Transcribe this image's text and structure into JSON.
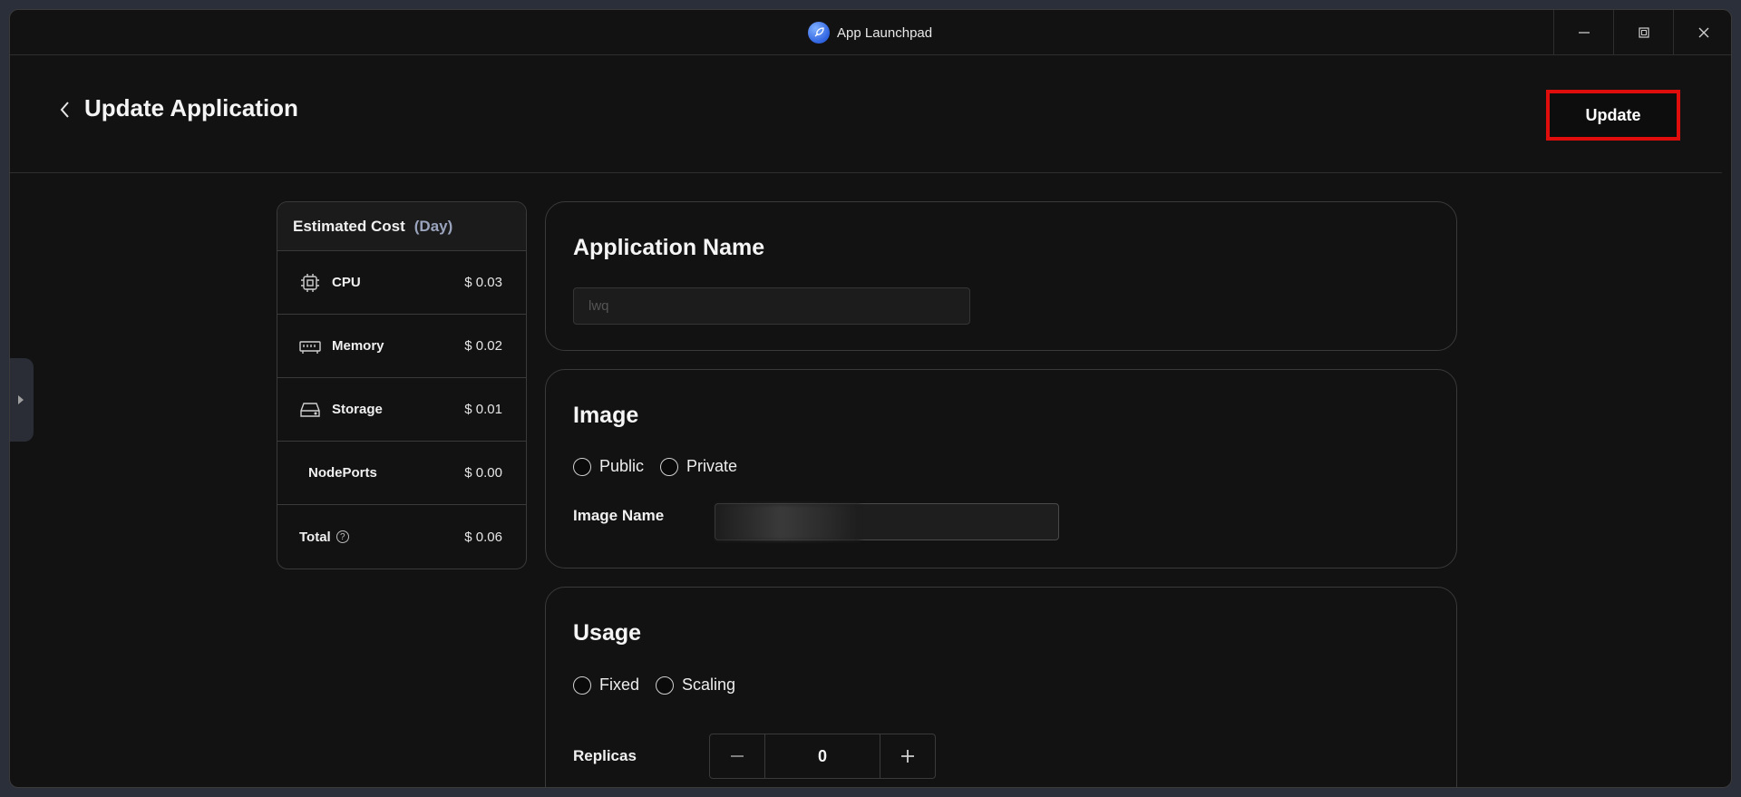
{
  "window": {
    "app_title": "App Launchpad"
  },
  "header": {
    "title": "Update Application",
    "update_label": "Update"
  },
  "cost": {
    "title": "Estimated Cost",
    "unit": "(Day)",
    "items": [
      {
        "label": "CPU",
        "value": "$ 0.03",
        "icon": "cpu-icon"
      },
      {
        "label": "Memory",
        "value": "$ 0.02",
        "icon": "memory-icon"
      },
      {
        "label": "Storage",
        "value": "$ 0.01",
        "icon": "storage-icon"
      },
      {
        "label": "NodePorts",
        "value": "$ 0.00",
        "icon": ""
      },
      {
        "label": "Total",
        "value": "$ 0.06",
        "icon": "help-icon"
      }
    ]
  },
  "app_name": {
    "title": "Application Name",
    "placeholder": "lwq"
  },
  "image": {
    "title": "Image",
    "options": [
      "Public",
      "Private"
    ],
    "name_label": "Image Name"
  },
  "usage": {
    "title": "Usage",
    "options": [
      "Fixed",
      "Scaling"
    ],
    "replicas_label": "Replicas",
    "replicas_value": "0"
  },
  "colors": {
    "highlight": "#e00d0d",
    "background": "#121212",
    "border": "#3a3a3a"
  }
}
